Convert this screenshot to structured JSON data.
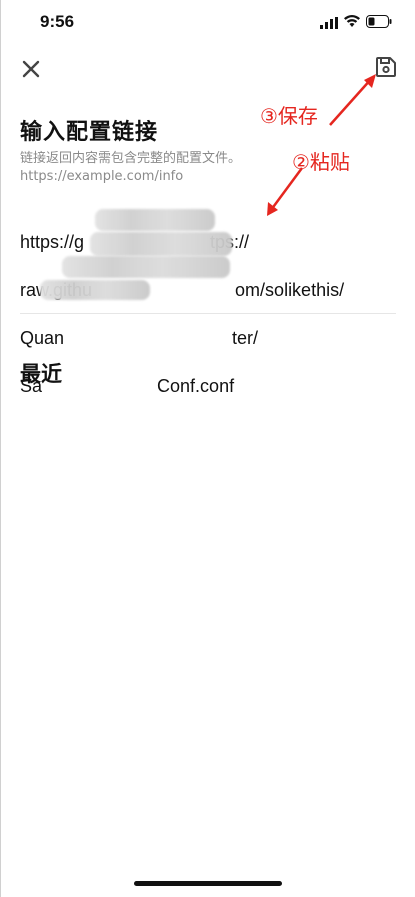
{
  "status": {
    "time": "9:56"
  },
  "icons": {
    "close": "close-icon",
    "save": "save-floppy-icon",
    "signal": "cellular-signal-icon",
    "wifi": "wifi-icon",
    "battery": "battery-icon"
  },
  "header": {
    "title": "输入配置链接",
    "description": "链接返回内容需包含完整的配置文件。",
    "example_url": "https://example.com/info"
  },
  "input": {
    "line1": "https://g",
    "line1_end": "tps://",
    "line2": "raw.githu",
    "line2_end": "om/solikethis/",
    "line3": "Quan",
    "line3_end": "ter/",
    "line4": "Sa",
    "line4_end": "Conf.conf"
  },
  "recent": {
    "title": "最近"
  },
  "annotations": {
    "paste": "②粘贴",
    "save": "③保存",
    "color": "#e5261f"
  }
}
